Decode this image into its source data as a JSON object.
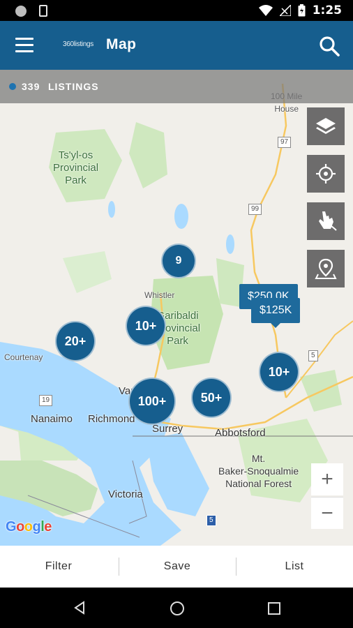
{
  "status_bar": {
    "time": "1:25"
  },
  "app_bar": {
    "logo_text": "360listings",
    "title": "Map"
  },
  "listings": {
    "count": "339",
    "label": "LISTINGS"
  },
  "map_labels": [
    {
      "text": "100 Mile\nHouse"
    },
    {
      "text": "Ts'yl-os\nProvincial\nPark"
    },
    {
      "text": "Whistler"
    },
    {
      "text": "Garibaldi\nProvincial\nPark"
    },
    {
      "text": "Courtenay"
    },
    {
      "text": "Nanaimo"
    },
    {
      "text": "Richmond"
    },
    {
      "text": "Surrey"
    },
    {
      "text": "Abbotsford"
    },
    {
      "text": "Mt.\nBaker-Snoqualmie\nNational Forest"
    },
    {
      "text": "Victoria"
    },
    {
      "text": "Vancouver"
    }
  ],
  "route_shields": [
    "97",
    "99",
    "5",
    "19",
    "5"
  ],
  "clusters": [
    {
      "label": "9"
    },
    {
      "label": "10+"
    },
    {
      "label": "20+"
    },
    {
      "label": "10+"
    },
    {
      "label": "100+"
    },
    {
      "label": "50+"
    }
  ],
  "price_markers": [
    {
      "label": "$250.0K"
    },
    {
      "label": "$125K"
    }
  ],
  "map_controls": {
    "layers": "layers-icon",
    "locate": "crosshair-icon",
    "draw": "draw-hand-icon",
    "pin": "location-pin-icon",
    "zoom_in": "+",
    "zoom_out": "−"
  },
  "attribution": "Google",
  "bottom_bar": {
    "filter": "Filter",
    "save": "Save",
    "list": "List"
  },
  "colors": {
    "primary": "#165e8e",
    "water": "#aadaff",
    "park": "#c8e6b4"
  }
}
